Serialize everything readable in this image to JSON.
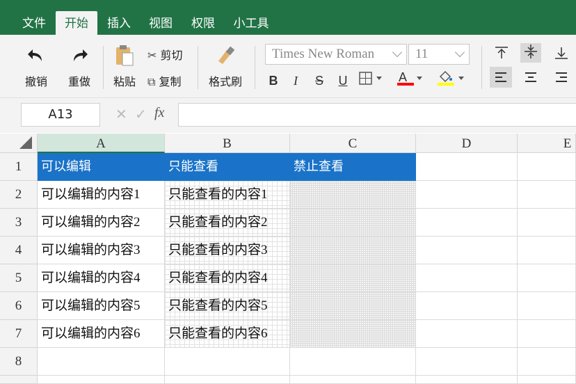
{
  "menu": {
    "tabs": [
      {
        "label": "文件"
      },
      {
        "label": "开始"
      },
      {
        "label": "插入"
      },
      {
        "label": "视图"
      },
      {
        "label": "权限"
      },
      {
        "label": "小工具"
      }
    ],
    "active_tab": "开始"
  },
  "ribbon": {
    "undo_label": "撤销",
    "redo_label": "重做",
    "paste_label": "粘贴",
    "cut_label": "剪切",
    "copy_label": "复制",
    "format_painter_label": "格式刷",
    "font_name": "Times New Roman",
    "font_size": "11",
    "bold": "B",
    "italic": "I",
    "strike": "S",
    "underline": "U",
    "font_color": "#ff0000",
    "fill_color": "#ffff00"
  },
  "formula_bar": {
    "cell_ref": "A13",
    "fx": "fx",
    "value": ""
  },
  "sheet": {
    "columns": [
      "A",
      "B",
      "C",
      "D",
      "E"
    ],
    "selected_column": "A",
    "rows": [
      "1",
      "2",
      "3",
      "4",
      "5",
      "6",
      "7",
      "8"
    ],
    "header_row": [
      "可以编辑",
      "只能查看",
      "禁止查看"
    ],
    "data": [
      [
        "可以编辑的内容1",
        "只能查看的内容1",
        ""
      ],
      [
        "可以编辑的内容2",
        "只能查看的内容2",
        ""
      ],
      [
        "可以编辑的内容3",
        "只能查看的内容3",
        ""
      ],
      [
        "可以编辑的内容4",
        "只能查看的内容4",
        ""
      ],
      [
        "可以编辑的内容5",
        "只能查看的内容5",
        ""
      ],
      [
        "可以编辑的内容6",
        "只能查看的内容6",
        ""
      ]
    ],
    "header_color": "#1a73c8",
    "theme_color": "#217346"
  }
}
